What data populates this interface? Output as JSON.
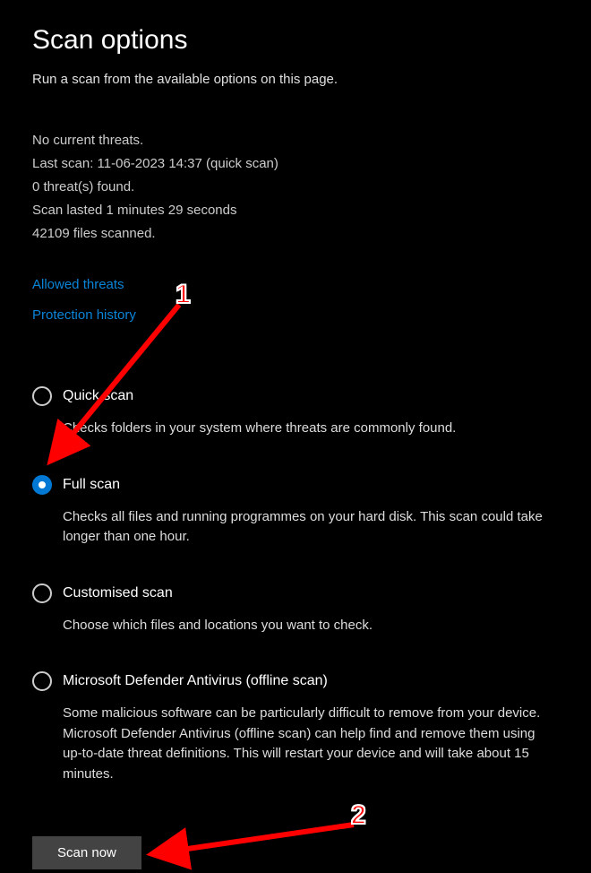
{
  "title": "Scan options",
  "subtitle": "Run a scan from the available options on this page.",
  "status": {
    "no_threats": "No current threats.",
    "last_scan": "Last scan: 11-06-2023 14:37 (quick scan)",
    "threats_found": "0 threat(s) found.",
    "duration": "Scan lasted 1 minutes 29 seconds",
    "files_scanned": "42109 files scanned."
  },
  "links": {
    "allowed_threats": "Allowed threats",
    "protection_history": "Protection history"
  },
  "options": [
    {
      "label": "Quick scan",
      "desc": "Checks folders in your system where threats are commonly found.",
      "selected": false
    },
    {
      "label": "Full scan",
      "desc": "Checks all files and running programmes on your hard disk. This scan could take longer than one hour.",
      "selected": true
    },
    {
      "label": "Customised scan",
      "desc": "Choose which files and locations you want to check.",
      "selected": false
    },
    {
      "label": "Microsoft Defender Antivirus (offline scan)",
      "desc": "Some malicious software can be particularly difficult to remove from your device. Microsoft Defender Antivirus (offline scan) can help find and remove them using up-to-date threat definitions. This will restart your device and will take about 15 minutes.",
      "selected": false
    }
  ],
  "scan_button": "Scan now",
  "annotations": {
    "one": "1",
    "two": "2"
  }
}
